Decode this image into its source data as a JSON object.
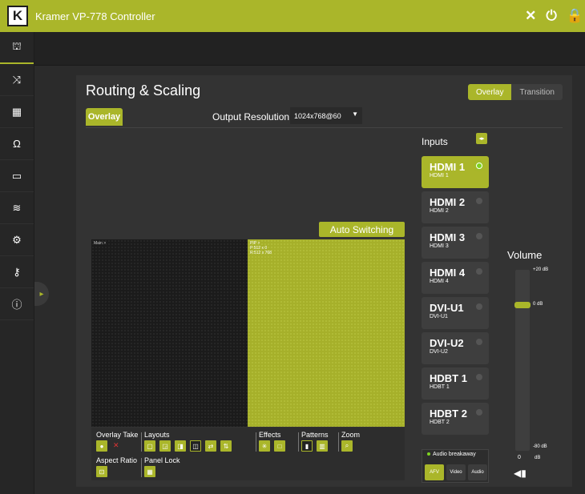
{
  "app": {
    "title": "Kramer VP-778 Controller",
    "logo_letter": "K"
  },
  "top_icons": [
    "fullscreen-icon",
    "power-icon",
    "lock-icon"
  ],
  "sidebar": {
    "items": [
      {
        "name": "hierarchy-icon",
        "glyph": "⛫"
      },
      {
        "name": "shuffle-icon",
        "glyph": "⤨"
      },
      {
        "name": "pattern-icon",
        "glyph": "▦"
      },
      {
        "name": "headphones-icon",
        "glyph": "Ω"
      },
      {
        "name": "monitor-icon",
        "glyph": "▭"
      },
      {
        "name": "sliders-icon",
        "glyph": "≋"
      },
      {
        "name": "tools-icon",
        "glyph": "⚙"
      },
      {
        "name": "key-icon",
        "glyph": "⚷"
      },
      {
        "name": "info-icon",
        "glyph": "ⓘ"
      }
    ],
    "toggle_glyph": "▸"
  },
  "panel": {
    "title": "Routing & Scaling",
    "mode_on": "Overlay",
    "mode_off": "Transition",
    "tab": "Overlay",
    "output_resolution_label": "Output Resolution",
    "output_resolution_value": "1024x768@60",
    "auto_switching": "Auto Switching",
    "main_window_label": "Main >",
    "pip_label_1": "PIP >",
    "pip_label_2": "P:512 x 0",
    "pip_label_3": "R:512 x 768"
  },
  "controls": {
    "overlay_take": "Overlay Take",
    "layouts": "Layouts",
    "effects": "Effects",
    "patterns": "Patterns",
    "zoom": "Zoom",
    "aspect_ratio": "Aspect Ratio",
    "panel_lock": "Panel Lock"
  },
  "inputs": {
    "title": "Inputs",
    "items": [
      {
        "name": "HDMI 1",
        "sub": "HDMI 1",
        "selected": true
      },
      {
        "name": "HDMI 2",
        "sub": "HDMI 2",
        "selected": false
      },
      {
        "name": "HDMI 3",
        "sub": "HDMI 3",
        "selected": false
      },
      {
        "name": "HDMI 4",
        "sub": "HDMI 4",
        "selected": false
      },
      {
        "name": "DVI-U1",
        "sub": "DVI-U1",
        "selected": false
      },
      {
        "name": "DVI-U2",
        "sub": "DVI-U2",
        "selected": false
      },
      {
        "name": "HDBT 1",
        "sub": "HDBT 1",
        "selected": false
      },
      {
        "name": "HDBT 2",
        "sub": "HDBT 2",
        "selected": false
      }
    ]
  },
  "audio": {
    "breakaway": "Audio breakaway",
    "afv": "AFV",
    "video": "Video",
    "audio": "Audio"
  },
  "volume": {
    "title": "Volume",
    "max_label": "+20 dB",
    "zero_label": "0 dB",
    "min_label": "-80 dB",
    "value": "0",
    "unit": "dB"
  },
  "colors": {
    "accent": "#aab62a",
    "background": "#2b2b2b",
    "panel": "#333333",
    "led_on": "#7ed321"
  }
}
